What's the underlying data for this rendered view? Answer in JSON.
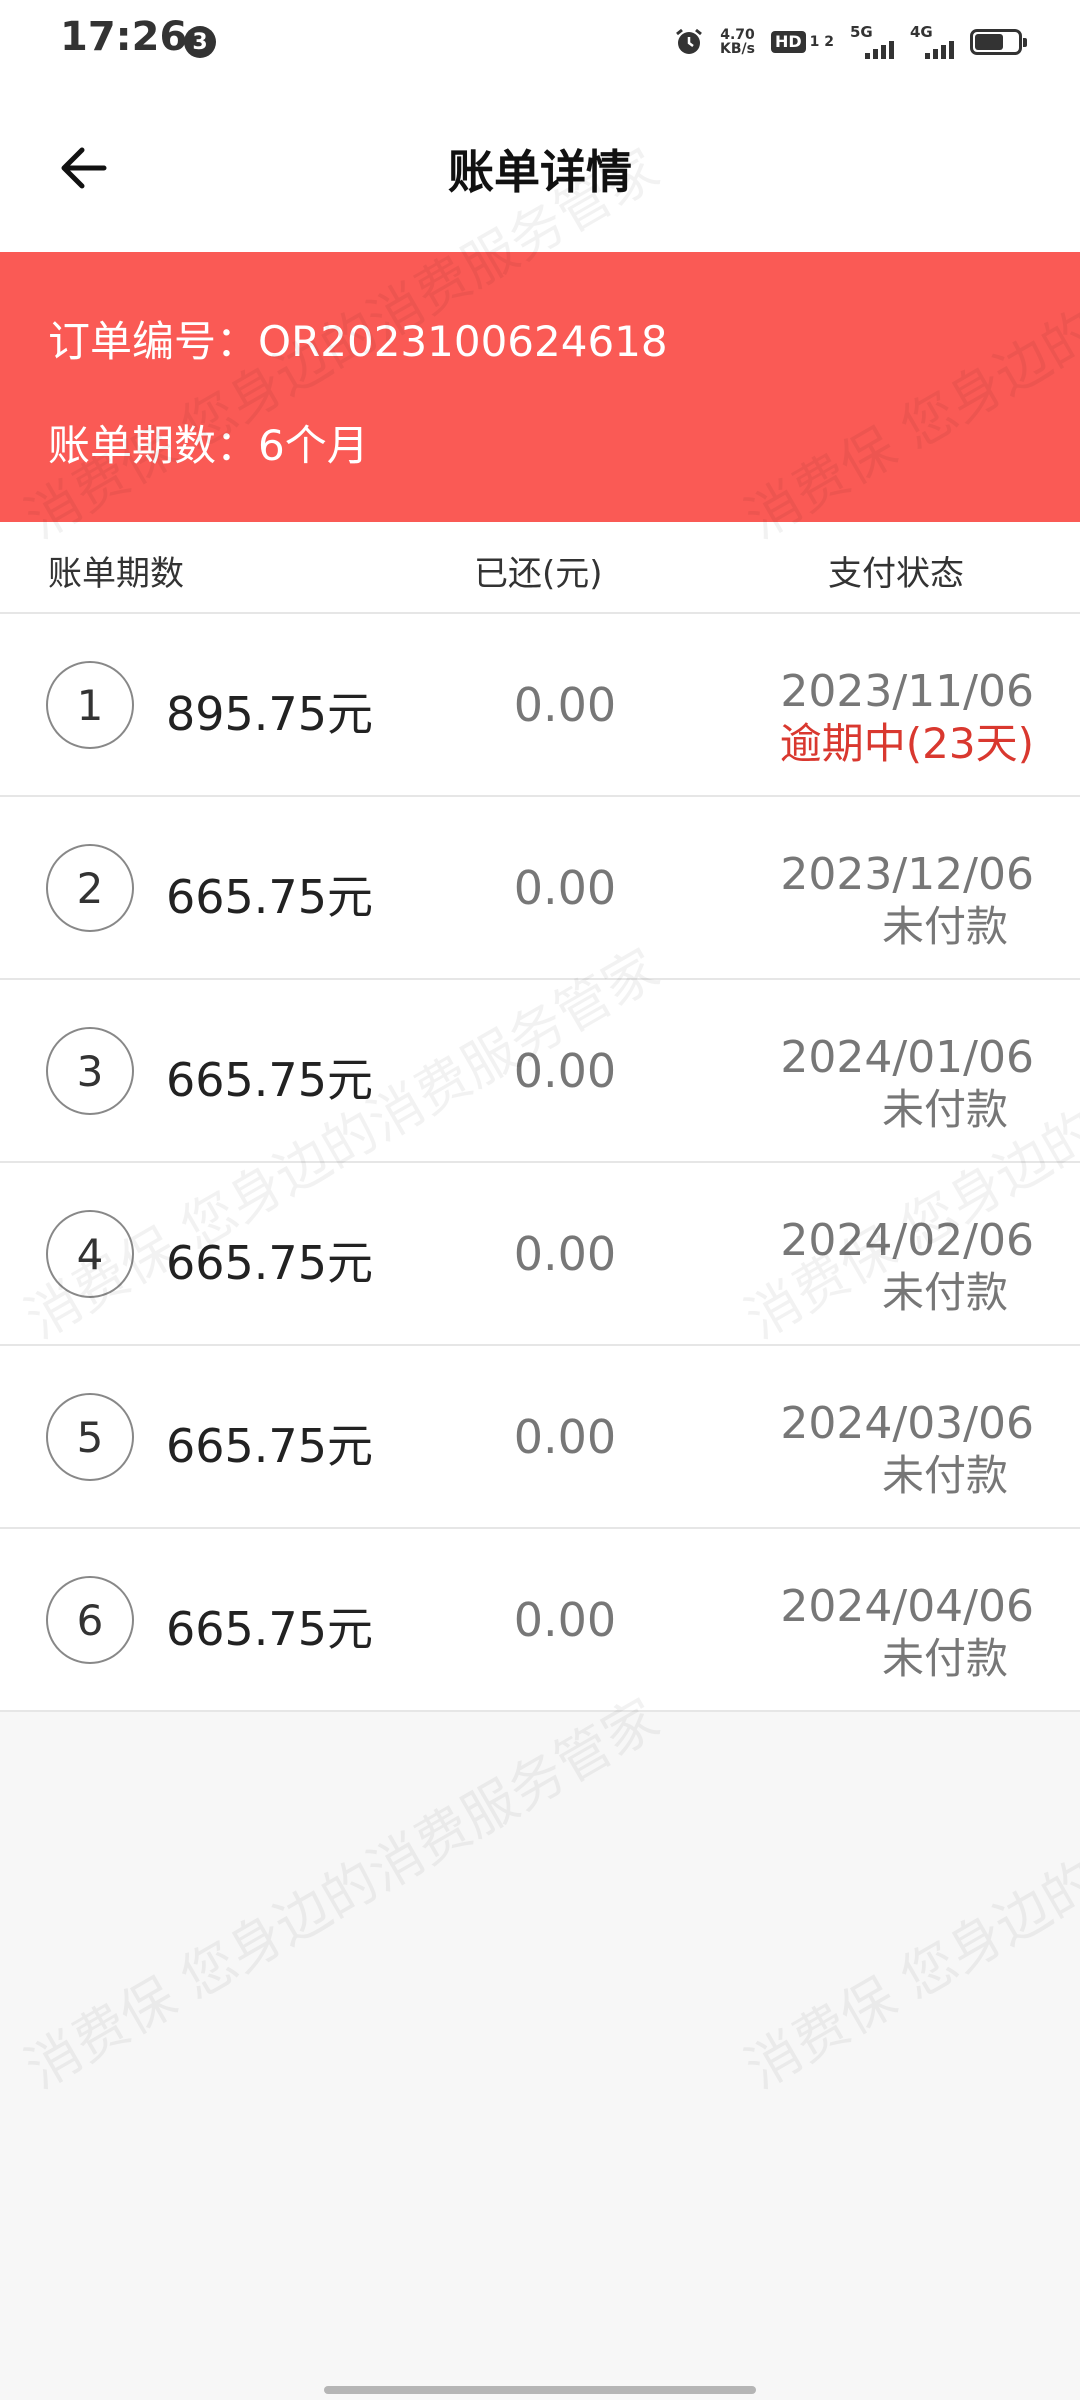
{
  "status_bar": {
    "time": "17:26",
    "notification_count": "3",
    "net_speed_value": "4.70",
    "net_speed_unit": "KB/s",
    "hd_label": "HD",
    "hd_sub": "1 2",
    "signal1_label": "5G",
    "signal2_label": "4G"
  },
  "header": {
    "title": "账单详情"
  },
  "order": {
    "number_label": "订单编号：",
    "number_value": "OR2023100624618",
    "period_label": "账单期数：",
    "period_value": "6个月"
  },
  "table": {
    "columns": [
      "账单期数",
      "已还(元)",
      "支付状态"
    ],
    "rows": [
      {
        "index": "1",
        "amount": "895.75元",
        "paid": "0.00",
        "date": "2023/11/06",
        "state": "逾期中(23天)",
        "overdue": true
      },
      {
        "index": "2",
        "amount": "665.75元",
        "paid": "0.00",
        "date": "2023/12/06",
        "state": "未付款",
        "overdue": false
      },
      {
        "index": "3",
        "amount": "665.75元",
        "paid": "0.00",
        "date": "2024/01/06",
        "state": "未付款",
        "overdue": false
      },
      {
        "index": "4",
        "amount": "665.75元",
        "paid": "0.00",
        "date": "2024/02/06",
        "state": "未付款",
        "overdue": false
      },
      {
        "index": "5",
        "amount": "665.75元",
        "paid": "0.00",
        "date": "2024/03/06",
        "state": "未付款",
        "overdue": false
      },
      {
        "index": "6",
        "amount": "665.75元",
        "paid": "0.00",
        "date": "2024/04/06",
        "state": "未付款",
        "overdue": false
      }
    ]
  },
  "watermark": {
    "text": "消费保 您身边的消费服务管家"
  },
  "colors": {
    "banner": "#fa5a55",
    "overdue": "#d9382f"
  }
}
